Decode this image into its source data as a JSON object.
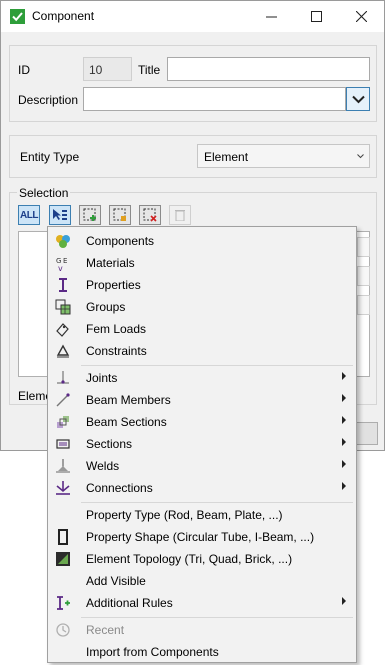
{
  "window": {
    "title": "Component"
  },
  "form": {
    "id_label": "ID",
    "id_value": "10",
    "title_label": "Title",
    "title_value": "",
    "description_label": "Description",
    "description_value": "",
    "entity_type_label": "Entity Type",
    "entity_type_value": "Element",
    "selection_label": "Selection",
    "all_button_label": "ALL",
    "element_label_partial": "Eleme"
  },
  "menu": {
    "group1": [
      {
        "label": "Components",
        "icon": "components-icon"
      },
      {
        "label": "Materials",
        "icon": "materials-icon"
      },
      {
        "label": "Properties",
        "icon": "properties-icon"
      },
      {
        "label": "Groups",
        "icon": "groups-icon"
      },
      {
        "label": "Fem Loads",
        "icon": "fem-loads-icon"
      },
      {
        "label": "Constraints",
        "icon": "constraints-icon"
      }
    ],
    "group2": [
      {
        "label": "Joints",
        "icon": "joints-icon"
      },
      {
        "label": "Beam Members",
        "icon": "beam-members-icon"
      },
      {
        "label": "Beam Sections",
        "icon": "beam-sections-icon"
      },
      {
        "label": "Sections",
        "icon": "sections-icon"
      },
      {
        "label": "Welds",
        "icon": "welds-icon"
      },
      {
        "label": "Connections",
        "icon": "connections-icon"
      }
    ],
    "group3": [
      {
        "label": "Property Type (Rod, Beam, Plate, ...)",
        "icon": ""
      },
      {
        "label": "Property Shape (Circular Tube, I-Beam, ...)",
        "icon": "property-shape-icon"
      },
      {
        "label": "Element Topology (Tri, Quad, Brick, ...)",
        "icon": "element-topology-icon"
      },
      {
        "label": "Add Visible",
        "icon": ""
      },
      {
        "label": "Additional Rules",
        "icon": "additional-rules-icon"
      }
    ],
    "group4": [
      {
        "label": "Recent",
        "icon": "recent-icon"
      },
      {
        "label": "Import from Components",
        "icon": ""
      }
    ]
  },
  "colors": {
    "accent": "#3c7fb1",
    "check_green": "#2e9e3a",
    "icon_purple": "#5b2a86"
  }
}
